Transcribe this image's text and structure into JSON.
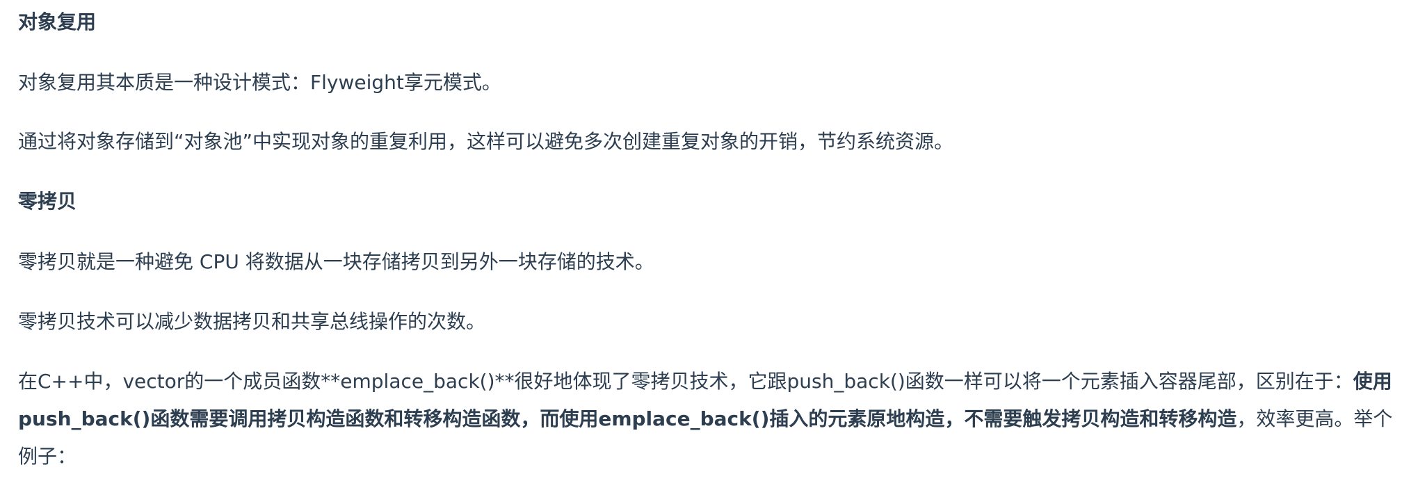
{
  "sections": [
    {
      "heading": "对象复用",
      "paragraphs": [
        "对象复用其本质是一种设计模式：Flyweight享元模式。",
        "通过将对象存储到“对象池”中实现对象的重复利用，这样可以避免多次创建重复对象的开销，节约系统资源。"
      ]
    },
    {
      "heading": "零拷贝",
      "paragraphs": [
        "零拷贝就是一种避免 CPU 将数据从一块存储拷贝到另外一块存储的技术。",
        "零拷贝技术可以减少数据拷贝和共享总线操作的次数。"
      ]
    }
  ],
  "last_paragraph": {
    "part1": "在C++中，vector的一个成员函数**emplace_back()**很好地体现了零拷贝技术，它跟push_back()函数一样可以将一个元素插入容器尾部，区别在于：",
    "bold": "使用push_back()函数需要调用拷贝构造函数和转移构造函数，而使用emplace_back()插入的元素原地构造，不需要触发拷贝构造和转移构造",
    "part2": "，效率更高。举个例子："
  }
}
